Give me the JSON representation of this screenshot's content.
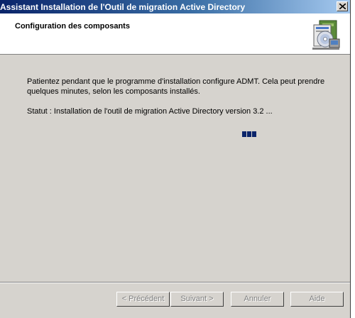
{
  "window": {
    "title": "Assistant Installation de l'Outil de migration Active Directory"
  },
  "header": {
    "title": "Configuration des composants",
    "icon": "installer-package-icon"
  },
  "content": {
    "message": "Patientez pendant que le programme d'installation configure ADMT. Cela peut prendre quelques minutes, selon les composants installés.",
    "status": "Statut : Installation de l'outil de migration Active Directory version 3.2 ..."
  },
  "progress": {
    "blocks": 3
  },
  "buttons": {
    "previous": "< Précédent",
    "next": "Suivant >",
    "cancel": "Annuler",
    "help": "Aide"
  },
  "colors": {
    "titlebar_start": "#0a246a",
    "titlebar_end": "#a6caf0",
    "dialog_bg": "#d6d3ce",
    "progress": "#0a246a"
  }
}
